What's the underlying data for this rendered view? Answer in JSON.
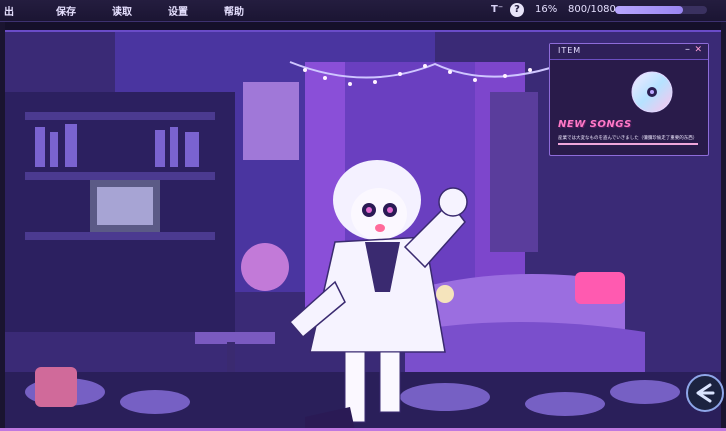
{
  "menu": {
    "items": [
      {
        "key": "quit",
        "label": "退出",
        "visible_label": "出"
      },
      {
        "key": "save",
        "label": "保存"
      },
      {
        "key": "load",
        "label": "读取"
      },
      {
        "key": "settings",
        "label": "设置"
      },
      {
        "key": "help",
        "label": "帮助"
      }
    ]
  },
  "status": {
    "text_speed_icon": "text-speed-icon",
    "help_icon": "?",
    "percent_label": "16%",
    "progress_label": "800/1080",
    "progress_fraction": 0.74
  },
  "item_popup": {
    "title": "ITEM",
    "minimize_label": "–",
    "close_label": "✕",
    "name": "NEW SONGS",
    "description": "産業では大変なものを盗んでいきました（彌彌珍偷走了重要的东西）",
    "icon": "cd-disc-icon"
  },
  "back": {
    "icon": "back-arrow-icon"
  },
  "colors": {
    "accent": "#9a86f2",
    "popup_border": "#8e6cd9",
    "new_songs": "#ff7ac8",
    "scene_purple": "#3b2a78"
  }
}
